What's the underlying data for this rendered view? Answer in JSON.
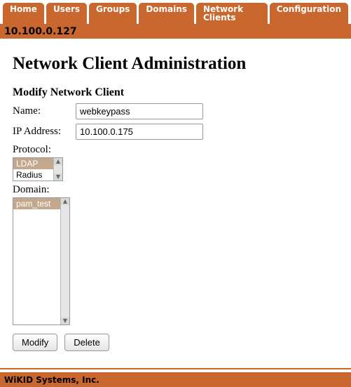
{
  "tabs": {
    "home": "Home",
    "users": "Users",
    "groups": "Groups",
    "domains": "Domains",
    "network_clients": "Network Clients",
    "configuration": "Configuration"
  },
  "ip_bar": "10.100.0.127",
  "page_title": "Network Client Administration",
  "subheading": "Modify Network Client",
  "form": {
    "name_label": "Name:",
    "name_value": "webkeypass",
    "ip_label": "IP Address:",
    "ip_value": "10.100.0.175",
    "protocol_label": "Protocol:",
    "protocol_options": {
      "ldap": "LDAP",
      "radius": "Radius"
    },
    "protocol_selected": "LDAP",
    "domain_label": "Domain:",
    "domain_options": {
      "pam_test": "pam_test"
    },
    "domain_selected": "pam_test"
  },
  "buttons": {
    "modify": "Modify",
    "delete": "Delete"
  },
  "footer": "WiKID Systems, Inc."
}
